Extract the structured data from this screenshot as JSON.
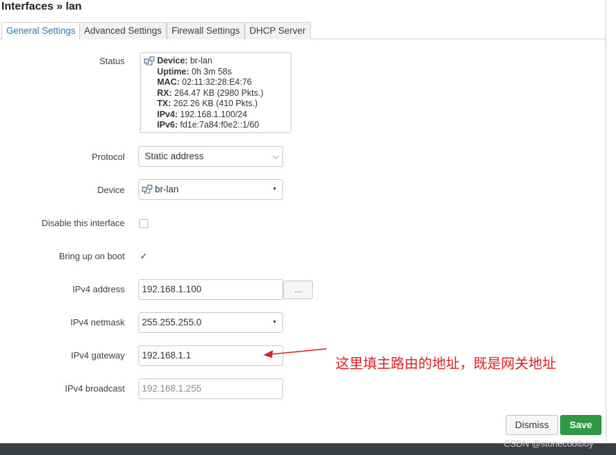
{
  "title": "Interfaces » lan",
  "tabs": [
    {
      "label": "General Settings",
      "active": true
    },
    {
      "label": "Advanced Settings",
      "active": false
    },
    {
      "label": "Firewall Settings",
      "active": false
    },
    {
      "label": "DHCP Server",
      "active": false
    }
  ],
  "status": {
    "label": "Status",
    "device_key": "Device:",
    "device_val": "br-lan",
    "uptime_key": "Uptime:",
    "uptime_val": "0h 3m 58s",
    "mac_key": "MAC:",
    "mac_val": "02:11:32:28:E4:76",
    "rx_key": "RX:",
    "rx_val": "264.47 KB (2980 Pkts.)",
    "tx_key": "TX:",
    "tx_val": "262.26 KB (410 Pkts.)",
    "ipv4_key": "IPv4:",
    "ipv4_val": "192.168.1.100/24",
    "ipv6_key": "IPv6:",
    "ipv6_val": "fd1e:7a84:f0e2::1/60"
  },
  "fields": {
    "protocol_label": "Protocol",
    "protocol_value": "Static address",
    "device_label": "Device",
    "device_value": "br-lan",
    "disable_label": "Disable this interface",
    "disable_checked": false,
    "boot_label": "Bring up on boot",
    "boot_checked": true,
    "ipv4_address_label": "IPv4 address",
    "ipv4_address_value": "192.168.1.100",
    "ipv4_address_more": "...",
    "ipv4_netmask_label": "IPv4 netmask",
    "ipv4_netmask_value": "255.255.255.0",
    "ipv4_gateway_label": "IPv4 gateway",
    "ipv4_gateway_value": "192.168.1.1",
    "ipv4_broadcast_label": "IPv4 broadcast",
    "ipv4_broadcast_placeholder": "192.168.1.255"
  },
  "annotation": {
    "text": "这里填主路由的地址，既是网关地址",
    "color": "#e02020"
  },
  "buttons": {
    "dismiss": "Dismiss",
    "save": "Save"
  },
  "watermark": "CSDN @stonecoolboy",
  "colors": {
    "accent": "#2a7ab0",
    "save": "#2f9a45"
  }
}
